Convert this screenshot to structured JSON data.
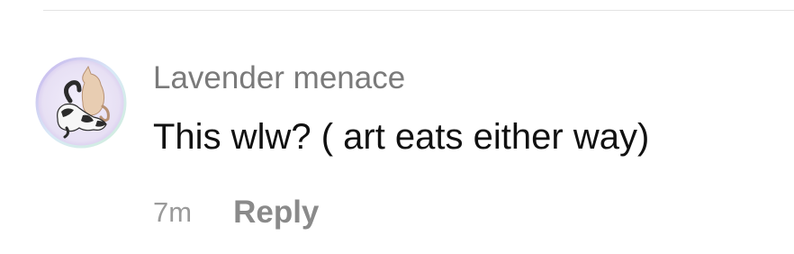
{
  "comment": {
    "username": "Lavender menace",
    "text": "This wlw? ( art eats either way)",
    "timestamp": "7m",
    "reply_label": "Reply",
    "avatar_icon": "cat-illustration-avatar"
  },
  "colors": {
    "username": "#7a7a7a",
    "text": "#111111",
    "timestamp": "#9a9a9a",
    "reply": "#8a8a8a",
    "divider": "#e3e3e3",
    "avatar_ring": "#c9b7e6"
  }
}
